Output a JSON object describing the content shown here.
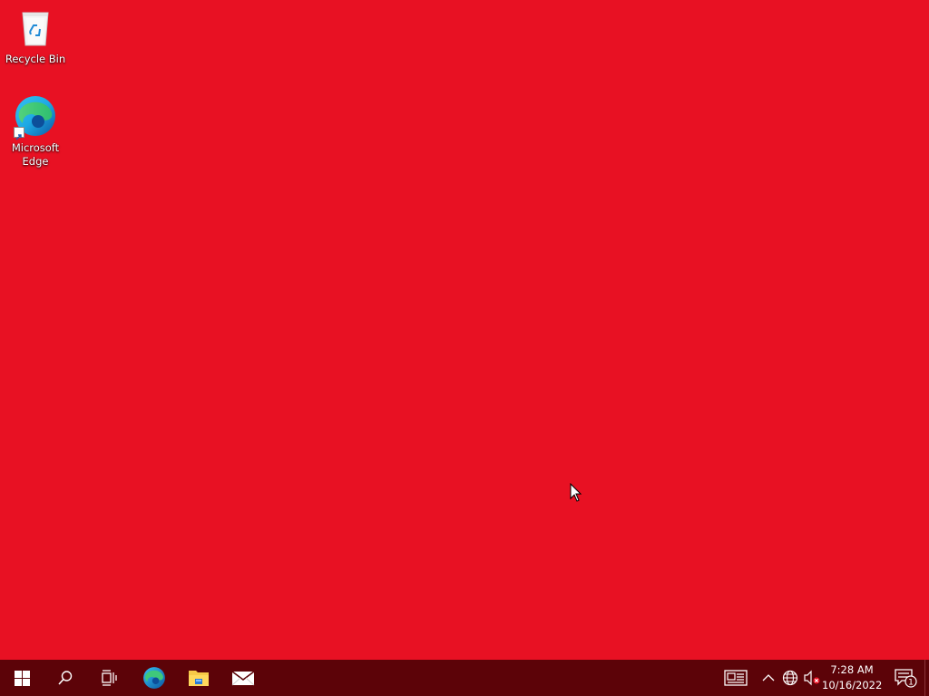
{
  "desktop": {
    "background": "#e81123",
    "icons": [
      {
        "label": "Recycle Bin",
        "icon": "recycle-bin-icon"
      },
      {
        "label": "Microsoft Edge",
        "icon": "edge-icon"
      }
    ]
  },
  "taskbar": {
    "background": "#5c0308",
    "start_icon": "windows-logo-icon",
    "search_icon": "search-icon",
    "taskview_icon": "task-view-icon",
    "pinned": [
      "edge-icon",
      "file-explorer-icon",
      "mail-icon"
    ],
    "tray": {
      "news_icon": "news-interests-icon",
      "chevron_icon": "chevron-up-icon",
      "network_icon": "network-globe-icon",
      "volume_icon": "volume-muted-icon",
      "time": "7:28 AM",
      "date": "10/16/2022",
      "notification_count": "1"
    }
  }
}
